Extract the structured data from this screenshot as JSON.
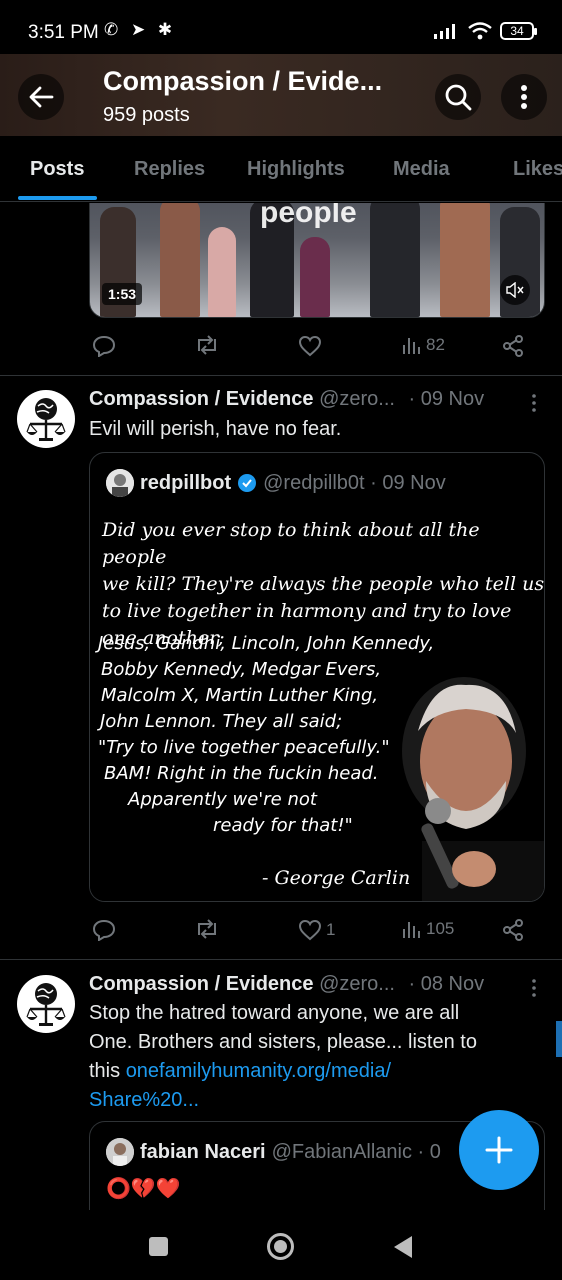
{
  "status_bar": {
    "time": "3:51 PM",
    "left_icons": "✆ ➤ ✱",
    "battery": "34"
  },
  "header": {
    "title": "Compassion / Evide...",
    "post_count": "959 posts"
  },
  "tabs": [
    {
      "label": "Posts"
    },
    {
      "label": "Replies"
    },
    {
      "label": "Highlights"
    },
    {
      "label": "Media"
    },
    {
      "label": "Likes"
    }
  ],
  "video_post": {
    "overlay_text": "people",
    "duration": "1:53",
    "views": "82"
  },
  "tweets": [
    {
      "name": "Compassion / Evidence",
      "handle": "@zero...",
      "date": "· 09 Nov",
      "text": "Evil will perish, have no fear.",
      "quote": {
        "name": "redpillbot",
        "handle": "@redpillb0t · 09 Nov",
        "meme_intro": [
          "Did you ever stop to think about all the people",
          "we kill? They're always the people who tell us",
          "to live together in harmony and try to love",
          "one another;"
        ],
        "meme_names": [
          "Jesus, Gandhi, Lincoln, John Kennedy,",
          "Bobby Kennedy, Medgar Evers,",
          "Malcolm X, Martin Luther King,",
          "John Lennon. They all said;",
          "\"Try to live together peacefully.\"",
          "BAM! Right in the fuckin head.",
          "Apparently we're not",
          "ready for that!\""
        ],
        "meme_attribution": "- George Carlin"
      },
      "likes": "1",
      "views": "105"
    },
    {
      "name": "Compassion / Evidence",
      "handle": "@zero...",
      "date": "· 08 Nov",
      "text_line1": "Stop the hatred toward anyone, we are all",
      "text_line2": "One. Brothers and sisters, please... listen to",
      "text_line3_prefix": "this ",
      "link_line1": "onefamilyhumanity.org/media/",
      "link_line2": "Share%20...",
      "quote": {
        "name": "fabian Naceri",
        "handle": "@FabianAllanic · 0",
        "emojis": "⭕💔❤️"
      }
    }
  ],
  "colors": {
    "accent": "#1d9bf0",
    "muted": "#71767b",
    "border": "#2f3336"
  }
}
